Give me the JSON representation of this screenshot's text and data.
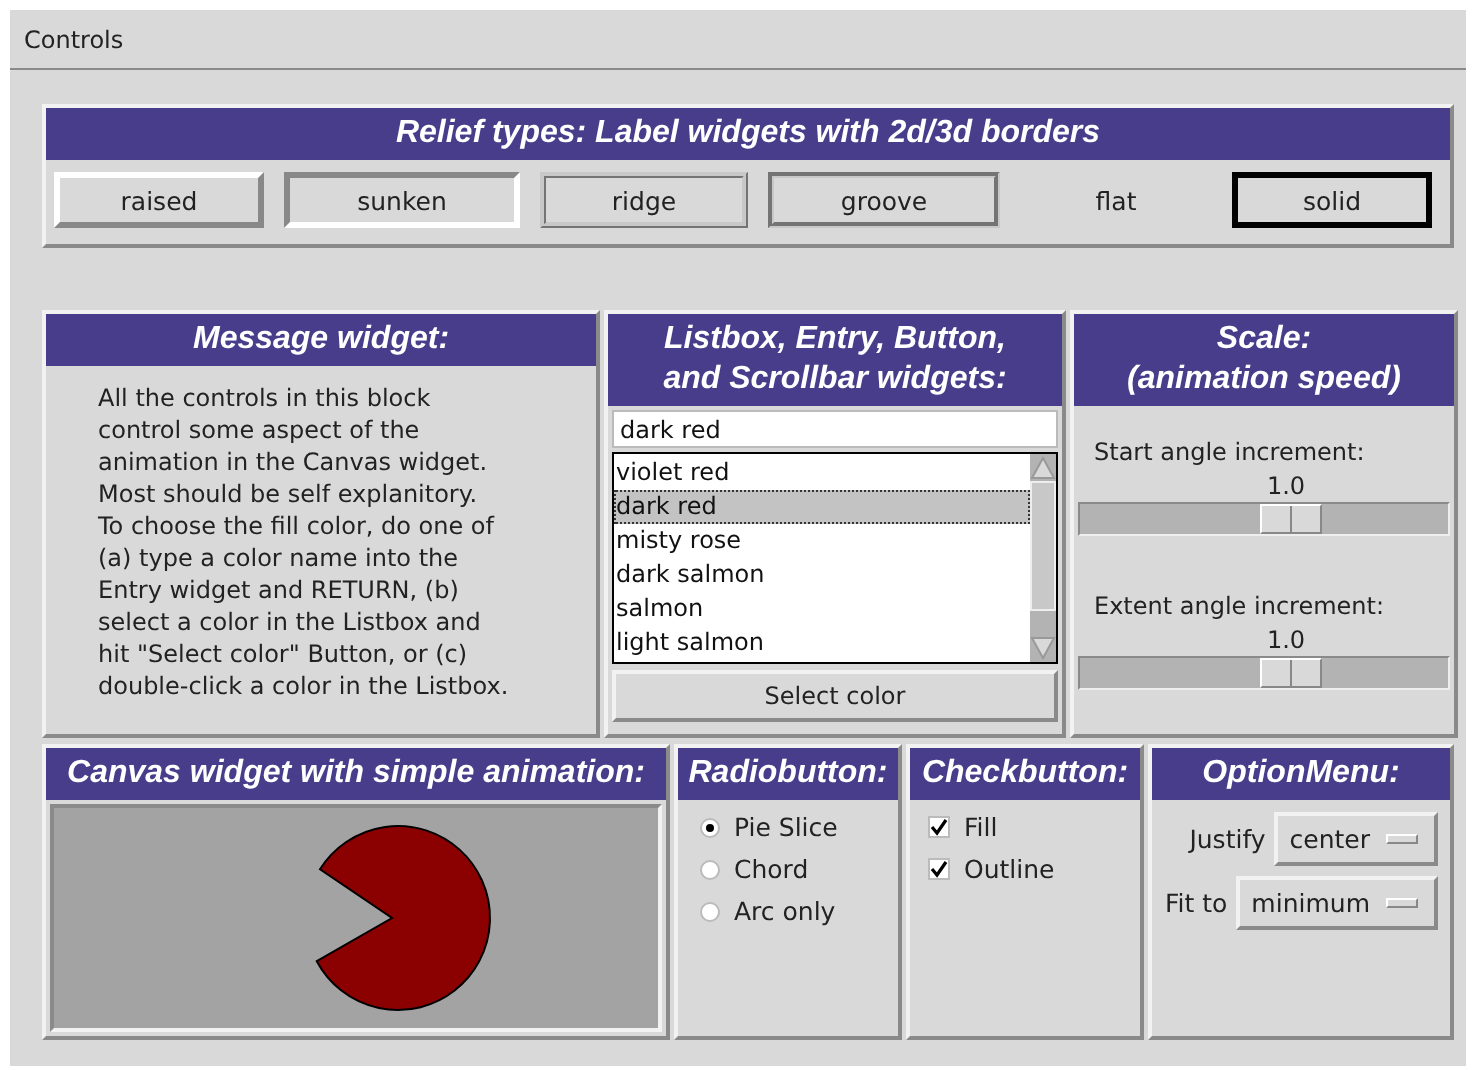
{
  "window": {
    "title": "Controls"
  },
  "relief": {
    "title": "Relief types: Label widgets with 2d/3d borders",
    "labels": [
      {
        "text": "raised",
        "kind": "raised"
      },
      {
        "text": "sunken",
        "kind": "sunken"
      },
      {
        "text": "ridge",
        "kind": "ridge"
      },
      {
        "text": "groove",
        "kind": "groove"
      },
      {
        "text": "flat",
        "kind": "flat"
      },
      {
        "text": "solid",
        "kind": "solid"
      }
    ]
  },
  "message": {
    "title": "Message widget:",
    "text": "All the controls in this block\ncontrol some aspect of the\nanimation in the Canvas widget.\nMost should be self explanitory.\nTo choose the fill color, do one of\n(a) type a color name into the\nEntry widget and RETURN, (b)\nselect a color in the Listbox and\nhit \"Select color\" Button, or (c)\ndouble-click a color in the Listbox."
  },
  "listbox": {
    "title_lines": [
      "Listbox, Entry, Button,",
      "and Scrollbar widgets:"
    ],
    "entry": "dark red",
    "items": [
      {
        "text": "violet red",
        "selected": false
      },
      {
        "text": "dark red",
        "selected": true
      },
      {
        "text": "misty rose",
        "selected": false
      },
      {
        "text": "dark salmon",
        "selected": false
      },
      {
        "text": "salmon",
        "selected": false
      },
      {
        "text": "light salmon",
        "selected": false
      }
    ],
    "button": "Select color"
  },
  "scale": {
    "title_lines": [
      "Scale:",
      "(animation speed)"
    ],
    "sliders": [
      {
        "label": "Start angle increment:",
        "reading": "1.0",
        "level": 0.59
      },
      {
        "label": "Extent angle increment:",
        "reading": "1.0",
        "level": 0.59
      }
    ]
  },
  "canvas": {
    "title": "Canvas widget with simple animation:"
  },
  "radio": {
    "title": "Radiobutton:",
    "options": [
      {
        "label": "Pie Slice",
        "selected": true
      },
      {
        "label": "Chord",
        "selected": false
      },
      {
        "label": "Arc only",
        "selected": false
      }
    ]
  },
  "check": {
    "title": "Checkbutton:",
    "options": [
      {
        "label": "Fill",
        "checked": true
      },
      {
        "label": "Outline",
        "checked": true
      }
    ]
  },
  "optionmenu": {
    "title": "OptionMenu:",
    "menus": [
      {
        "label": "Justify",
        "value": "center"
      },
      {
        "label": "Fit to",
        "value": "minimum"
      }
    ]
  }
}
